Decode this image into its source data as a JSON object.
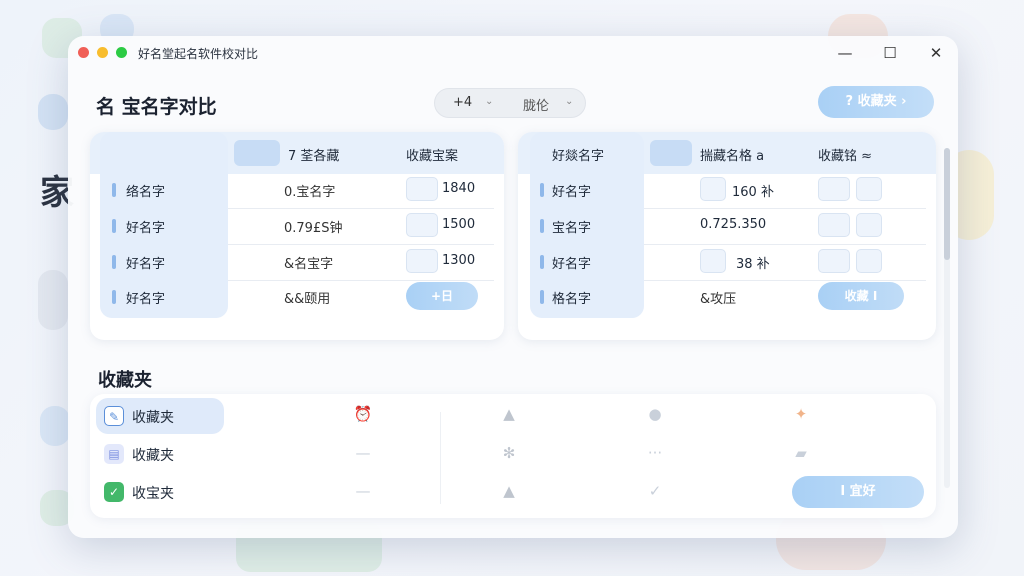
{
  "background": {
    "big_text": "家"
  },
  "window": {
    "title": "好名堂起名软件校对比",
    "controls": {
      "minimize": "—",
      "maximize": "☐",
      "close": "✕"
    }
  },
  "header": {
    "page_title": "名 宝名字对比",
    "segment": {
      "left": "+4",
      "right": "胧伦"
    },
    "fav_button": "? 收藏夹 ›"
  },
  "table_left": {
    "headers": [
      "7 荃各藏",
      "收藏宝案"
    ],
    "rows": [
      {
        "name": "络名字",
        "value": "0.宝名字",
        "count": "1840"
      },
      {
        "name": "好名字",
        "value": "0.79£S钟",
        "count": "1500"
      },
      {
        "name": "好名字",
        "value": "&名宝字",
        "count": "1300"
      },
      {
        "name": "好名字",
        "value": "&&颐用",
        "count": ""
      }
    ],
    "add_button": "+日"
  },
  "table_right": {
    "headers": [
      "好燚名字",
      "揣藏名格 a",
      "收藏铭 ≈"
    ],
    "rows": [
      {
        "name": "好名字",
        "value": "160 补"
      },
      {
        "name": "宝名字",
        "value": "0.725.350"
      },
      {
        "name": "好名字",
        "value": "38 补"
      },
      {
        "name": "格名字",
        "value": "&攻压"
      }
    ],
    "fav_button": "收藏 I"
  },
  "favorites": {
    "title": "收藏夹",
    "items": [
      {
        "label": "收藏夹",
        "icon": "edit-icon",
        "color": "#5b8fd9"
      },
      {
        "label": "收藏夹",
        "icon": "calendar-icon",
        "color": "#7c8fe0"
      },
      {
        "label": "收宝夹",
        "icon": "check-icon",
        "color": "#43b86a"
      }
    ],
    "go_button": "I 宜好"
  },
  "colors": {
    "accent": "#a9d0f5",
    "highlight": "#e4eefb"
  }
}
